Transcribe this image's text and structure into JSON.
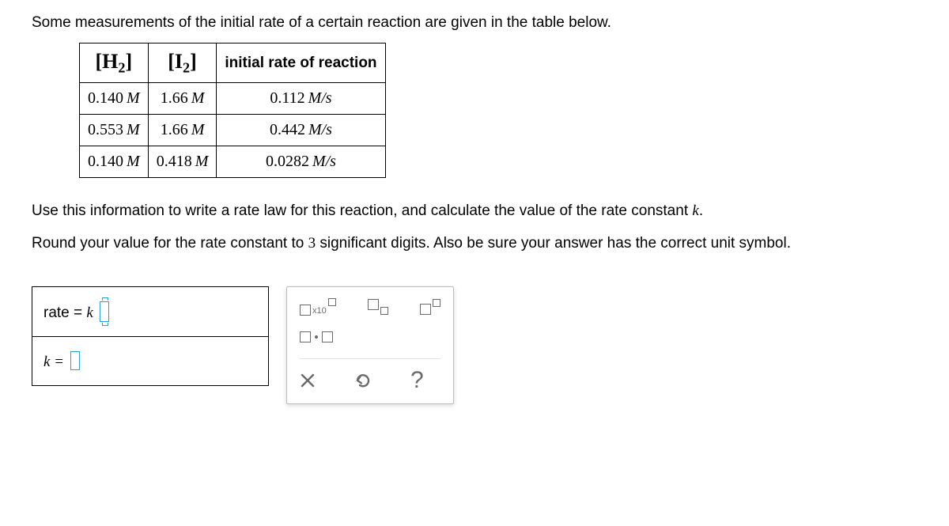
{
  "intro": "Some measurements of the initial rate of a certain reaction are given in the table below.",
  "table": {
    "headers": {
      "h2": "H",
      "h2_sub": "2",
      "i2": "I",
      "i2_sub": "2",
      "rate": "initial rate of reaction"
    },
    "rows": [
      {
        "h2": "0.140",
        "h2u": "M",
        "i2": "1.66",
        "i2u": "M",
        "rate": "0.112",
        "rateu": "M/s"
      },
      {
        "h2": "0.553",
        "h2u": "M",
        "i2": "1.66",
        "i2u": "M",
        "rate": "0.442",
        "rateu": "M/s"
      },
      {
        "h2": "0.140",
        "h2u": "M",
        "i2": "0.418",
        "i2u": "M",
        "rate": "0.0282",
        "rateu": "M/s"
      }
    ]
  },
  "instr1_a": "Use this information to write a rate law for this reaction, and calculate the value of the rate constant ",
  "instr1_k": "k",
  "instr1_b": ".",
  "instr2_a": "Round your value for the rate constant to ",
  "instr2_n": "3",
  "instr2_b": " significant digits. Also be sure your answer has the correct unit symbol.",
  "answer": {
    "rate_label": "rate = ",
    "k_sym": "k",
    "k_label": "k = "
  },
  "palette": {
    "x10": "x10"
  },
  "actions": {
    "help": "?"
  }
}
